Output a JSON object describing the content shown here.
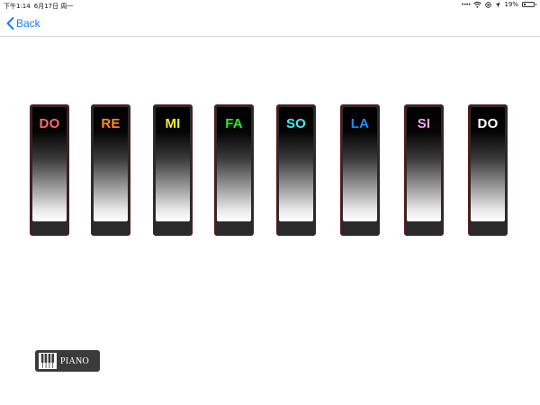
{
  "status_bar": {
    "time": "下午1:14",
    "date": "6月17日 周一",
    "battery_percent": "19%",
    "battery_level": 0.19
  },
  "nav": {
    "back_label": "Back"
  },
  "keys": [
    {
      "label": "DO",
      "color": "#ff6b6b"
    },
    {
      "label": "RE",
      "color": "#ff8c1a"
    },
    {
      "label": "MI",
      "color": "#f5f01a"
    },
    {
      "label": "FA",
      "color": "#2ee82e"
    },
    {
      "label": "SO",
      "color": "#3ff0f0"
    },
    {
      "label": "LA",
      "color": "#1a8cff"
    },
    {
      "label": "SI",
      "color": "#f0a8f0"
    },
    {
      "label": "DO",
      "color": "#ffffff"
    }
  ],
  "piano_button": {
    "label": "PIANO"
  },
  "colors": {
    "accent": "#1b7cf2",
    "key_border": "#5a1a1a",
    "button_bg": "#3b3b3b"
  }
}
